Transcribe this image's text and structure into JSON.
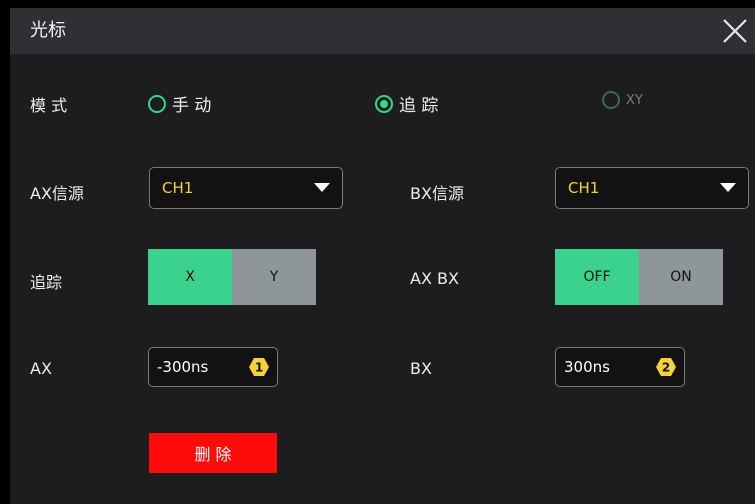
{
  "dialog": {
    "title": "光标"
  },
  "mode": {
    "label": "模 式",
    "options": [
      {
        "label": "手 动",
        "selected": false,
        "disabled": false
      },
      {
        "label": "追 踪",
        "selected": true,
        "disabled": false
      },
      {
        "label": "XY",
        "selected": false,
        "disabled": true
      }
    ]
  },
  "ax_source": {
    "label": "AX信源",
    "value": "CH1"
  },
  "bx_source": {
    "label": "BX信源",
    "value": "CH1"
  },
  "track": {
    "label": "追踪",
    "options": [
      "X",
      "Y"
    ],
    "selected": "X"
  },
  "axbx": {
    "label": "AX BX",
    "options": [
      "OFF",
      "ON"
    ],
    "selected": "OFF"
  },
  "ax": {
    "label": "AX",
    "value": "-300ns",
    "knob": "1"
  },
  "bx": {
    "label": "BX",
    "value": "300ns",
    "knob": "2"
  },
  "delete_label": "删 除",
  "colors": {
    "accent": "#3ad28c",
    "value_yellow": "#f6d23a",
    "delete_red": "#ff0b0b",
    "title_bar": "#2e3033"
  }
}
